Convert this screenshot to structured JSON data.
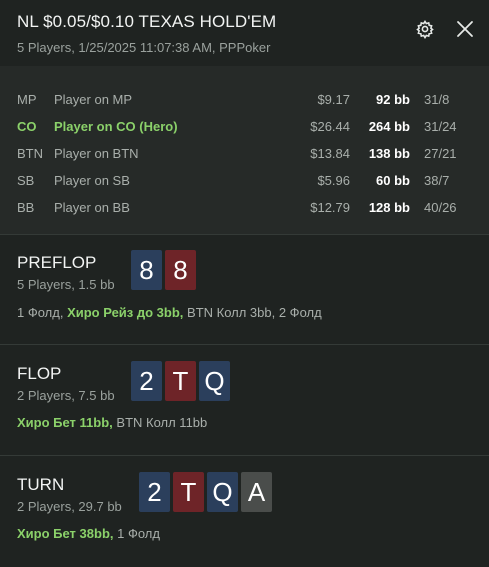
{
  "header": {
    "title": "NL $0.05/$0.10 TEXAS HOLD'EM",
    "subtitle": "5 Players, 1/25/2025 11:07:38 AM, PPPoker"
  },
  "icons": {
    "settings": "gear-icon",
    "close": "close-icon"
  },
  "colors": {
    "hero_green": "#8bd16a",
    "card_blue": "#2b3f5c",
    "card_red": "#6e2428",
    "card_gray": "#4a4d4b"
  },
  "players": [
    {
      "pos": "MP",
      "name": "Player on MP",
      "money": "$9.17",
      "bb": "92 bb",
      "stat": "31/8",
      "hero": false
    },
    {
      "pos": "CO",
      "name": "Player on CO (Hero)",
      "money": "$26.44",
      "bb": "264 bb",
      "stat": "31/24",
      "hero": true
    },
    {
      "pos": "BTN",
      "name": "Player on BTN",
      "money": "$13.84",
      "bb": "138 bb",
      "stat": "27/21",
      "hero": false
    },
    {
      "pos": "SB",
      "name": "Player on SB",
      "money": "$5.96",
      "bb": "60 bb",
      "stat": "38/7",
      "hero": false
    },
    {
      "pos": "BB",
      "name": "Player on BB",
      "money": "$12.79",
      "bb": "128 bb",
      "stat": "40/26",
      "hero": false
    }
  ],
  "streets": [
    {
      "name": "PREFLOP",
      "sub": "5 Players, 1.5 bb",
      "cards": [
        {
          "rank": "8",
          "color": "blue"
        },
        {
          "rank": "8",
          "color": "red"
        }
      ],
      "actions": {
        "pre": "1 Фолд, ",
        "hero": "Хиро Рейз до 3bb,",
        "post": " BTN Колл 3bb, 2 Фолд"
      }
    },
    {
      "name": "FLOP",
      "sub": "2 Players, 7.5 bb",
      "cards": [
        {
          "rank": "2",
          "color": "blue"
        },
        {
          "rank": "T",
          "color": "red"
        },
        {
          "rank": "Q",
          "color": "blue"
        }
      ],
      "actions": {
        "pre": "",
        "hero": "Хиро Бет 11bb,",
        "post": " BTN Колл 11bb"
      }
    },
    {
      "name": "TURN",
      "sub": "2 Players, 29.7 bb",
      "cards": [
        {
          "rank": "2",
          "color": "blue"
        },
        {
          "rank": "T",
          "color": "red"
        },
        {
          "rank": "Q",
          "color": "blue"
        },
        {
          "rank": "A",
          "color": "gray"
        }
      ],
      "actions": {
        "pre": "",
        "hero": "Хиро Бет 38bb,",
        "post": " 1 Фолд"
      }
    }
  ]
}
